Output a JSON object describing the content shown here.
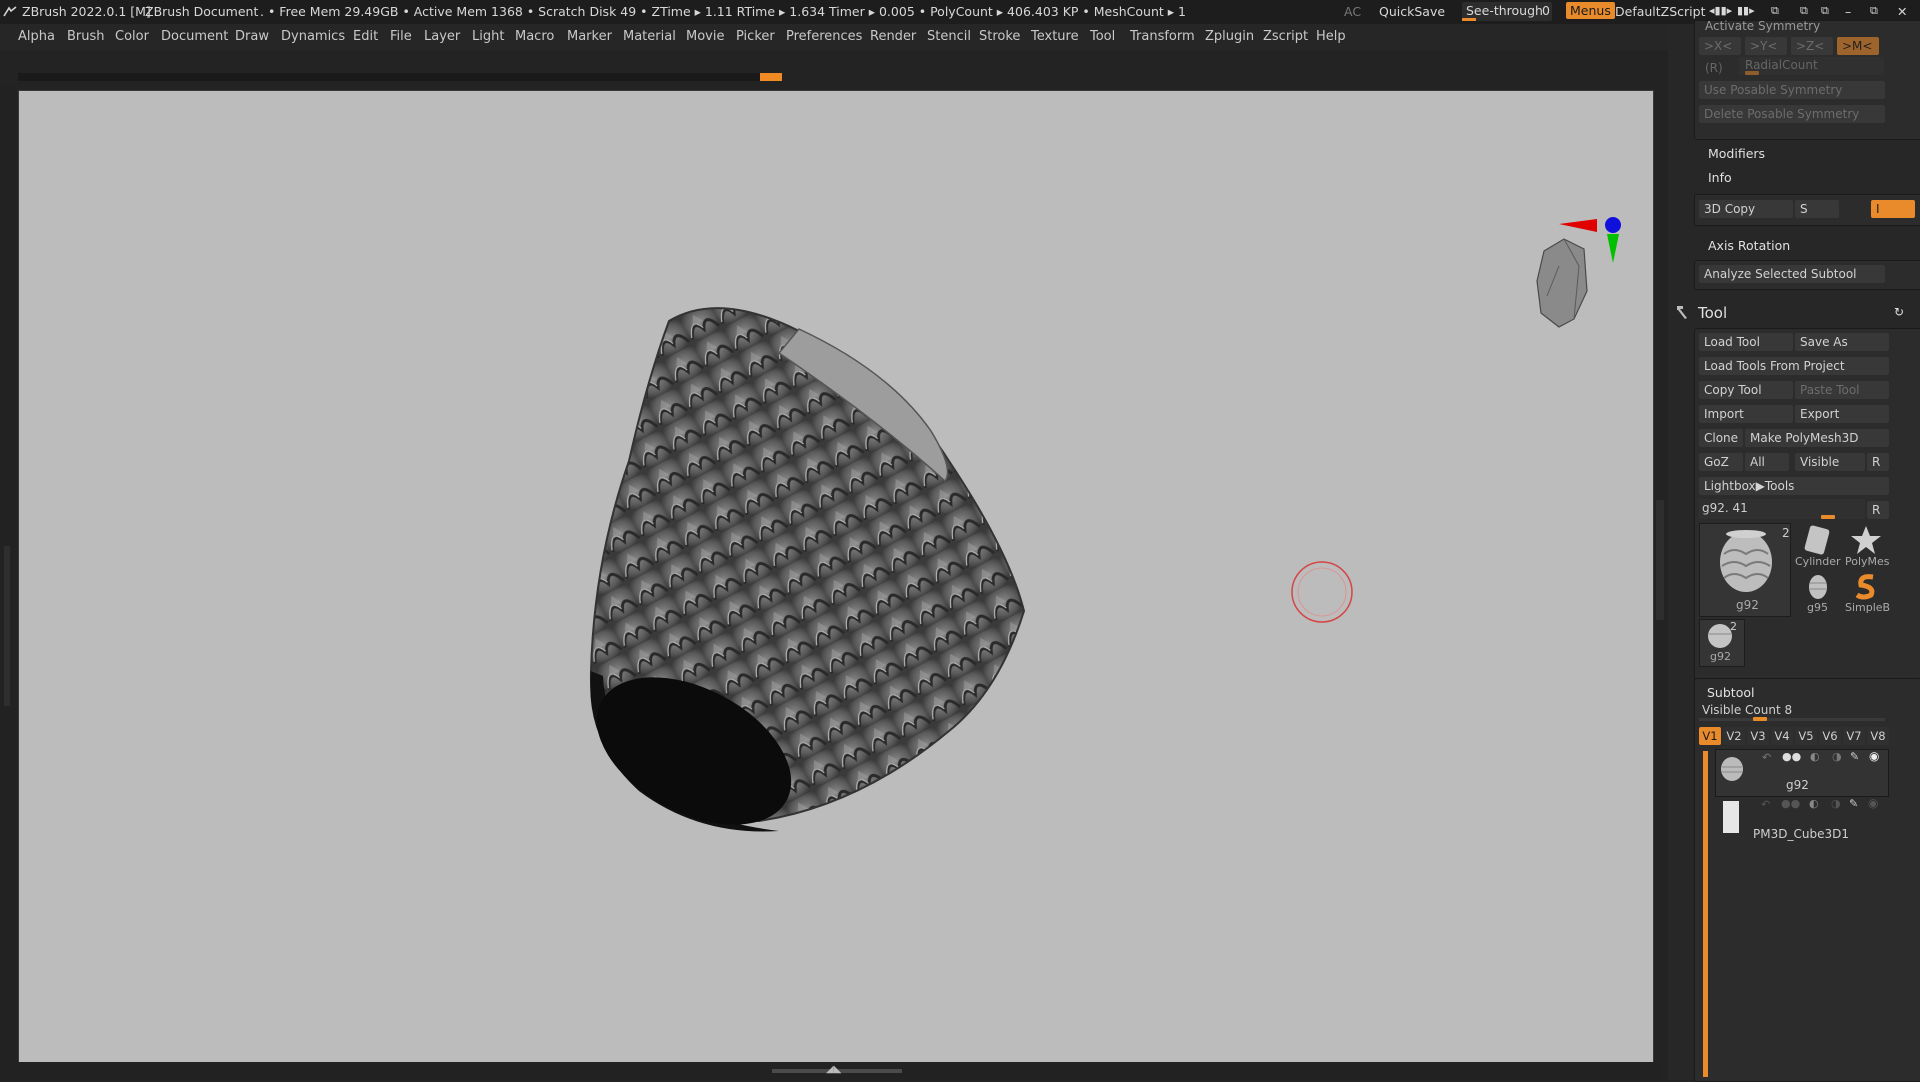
{
  "titlebar": {
    "app_title": "ZBrush 2022.0.1 [M]",
    "document": "ZBrush Document",
    "stats": ". • Free Mem 29.49GB • Active Mem 1368 • Scratch Disk 49 •  ZTime ▸ 1.11 RTime ▸ 1.634 Timer ▸ 0.005 • PolyCount ▸ 406.403 KP  • MeshCount ▸ 1",
    "ac": "AC",
    "quicksave": "QuickSave",
    "see_through_label": "See-through",
    "see_through_value": "0",
    "menus": "Menus",
    "default_zscript": "DefaultZScript"
  },
  "menubar": {
    "items": [
      "Alpha",
      "Brush",
      "Color",
      "Document",
      "Draw",
      "Dynamics",
      "Edit",
      "File",
      "Layer",
      "Light",
      "Macro",
      "Marker",
      "Material",
      "Movie",
      "Picker",
      "Preferences",
      "Render",
      "Stencil",
      "Stroke",
      "Texture",
      "Tool",
      "Transform",
      "Zplugin",
      "Zscript",
      "Help"
    ]
  },
  "right_panel": {
    "symmetry": {
      "activate_symmetry": "Activate Symmetry",
      "x": ">X<",
      "y": ">Y<",
      "z": ">Z<",
      "m": ">M<",
      "r": "(R)",
      "radial_count": "RadialCount",
      "use_posable": "Use Posable Symmetry",
      "delete_posable": "Delete Posable Symmetry"
    },
    "modifiers": "Modifiers",
    "info": "Info",
    "copy3d": {
      "label": "3D Copy",
      "s": "S",
      "value": "I"
    },
    "axis_rotation": "Axis Rotation",
    "analyze_subtool": "Analyze Selected Subtool",
    "tool": {
      "title": "Tool",
      "load_tool": "Load Tool",
      "save_as": "Save As",
      "load_from_project": "Load Tools From Project",
      "copy_tool": "Copy Tool",
      "paste_tool": "Paste Tool",
      "import": "Import",
      "export": "Export",
      "clone": "Clone",
      "make_polymesh": "Make PolyMesh3D",
      "goz": "GoZ",
      "all": "All",
      "visible": "Visible",
      "r": "R",
      "lightbox_tools": "Lightbox▶Tools",
      "current_tool": "g92. 41",
      "current_r": "R",
      "thumbs": {
        "main_name": "g92",
        "main_count": "2",
        "cylinder": "Cylinder",
        "polymesh": "PolyMes",
        "g95": "g95",
        "simpleb": "SimpleB",
        "small_name": "g92",
        "small_count": "2"
      }
    },
    "subtool": {
      "title": "Subtool",
      "visible_count": "Visible Count 8",
      "tabs": [
        "V1",
        "V2",
        "V3",
        "V4",
        "V5",
        "V6",
        "V7",
        "V8"
      ],
      "items": [
        {
          "name": "g92"
        },
        {
          "name": "PM3D_Cube3D1"
        }
      ]
    }
  },
  "colors": {
    "accent": "#e98a2b",
    "canvas": "#bcbcbc",
    "brush_cursor": "#d64545"
  }
}
